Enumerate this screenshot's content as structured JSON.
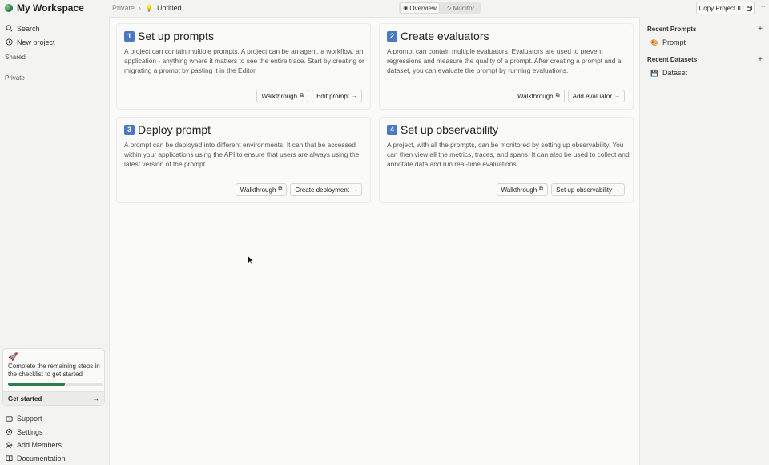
{
  "workspace": {
    "name": "My Workspace"
  },
  "sidebar": {
    "items": [
      {
        "label": "Search",
        "icon": "search-icon"
      },
      {
        "label": "New project",
        "icon": "plus-circle-icon"
      }
    ],
    "sections": {
      "shared": "Shared",
      "private": "Private"
    },
    "checklist": {
      "message": "Complete the remaining steps in the checklist to get started",
      "progress": 0.6,
      "action": "Get started"
    },
    "bottom_items": [
      {
        "label": "Support",
        "icon": "support-icon"
      },
      {
        "label": "Settings",
        "icon": "gear-icon"
      },
      {
        "label": "Add Members",
        "icon": "add-user-icon"
      },
      {
        "label": "Documentation",
        "icon": "book-icon"
      }
    ]
  },
  "header": {
    "breadcrumb": {
      "parent": "Private",
      "title": "Untitled"
    },
    "tabs": [
      {
        "label": "Overview",
        "active": true
      },
      {
        "label": "Monitor",
        "active": false
      }
    ],
    "copy_button": "Copy Project ID",
    "more": "⋯"
  },
  "cards": [
    {
      "num": "1",
      "title": "Set up prompts",
      "description": "A project can contain multiple prompts. A project can be an agent, a workflow, an application - anything where it matters to see the entire trace. Start by creating or migrating a prompt by pasting it in the Editor.",
      "walkthrough": "Walkthrough",
      "action": "Edit prompt"
    },
    {
      "num": "2",
      "title": "Create evaluators",
      "description": "A prompt can contain multiple evaluators. Evaluators are used to prevent regressions and measure the quality of a prompt. After creating a prompt and a dataset, you can evaluate the prompt by running evaluations.",
      "walkthrough": "Walkthrough",
      "action": "Add evaluator"
    },
    {
      "num": "3",
      "title": "Deploy prompt",
      "description": "A prompt can be deployed into different environments. It can that be accessed within your applications using the API to ensure that users are always using the latest version of the prompt.",
      "walkthrough": "Walkthrough",
      "action": "Create deployment"
    },
    {
      "num": "4",
      "title": "Set up observability",
      "description": "A project, with all the prompts, can be monitored by setting up observability. You can then view all the metrics, traces, and spans. It can also be used to collect and annotate data and run real-time evaluations.",
      "walkthrough": "Walkthrough",
      "action": "Set up observability"
    }
  ],
  "right_panel": {
    "recent_prompts": {
      "title": "Recent Prompts",
      "items": [
        "Prompt"
      ]
    },
    "recent_datasets": {
      "title": "Recent Datasets",
      "items": [
        "Dataset"
      ]
    }
  },
  "colors": {
    "accent": "#2e7d4f",
    "badge": "#4a78c2"
  }
}
